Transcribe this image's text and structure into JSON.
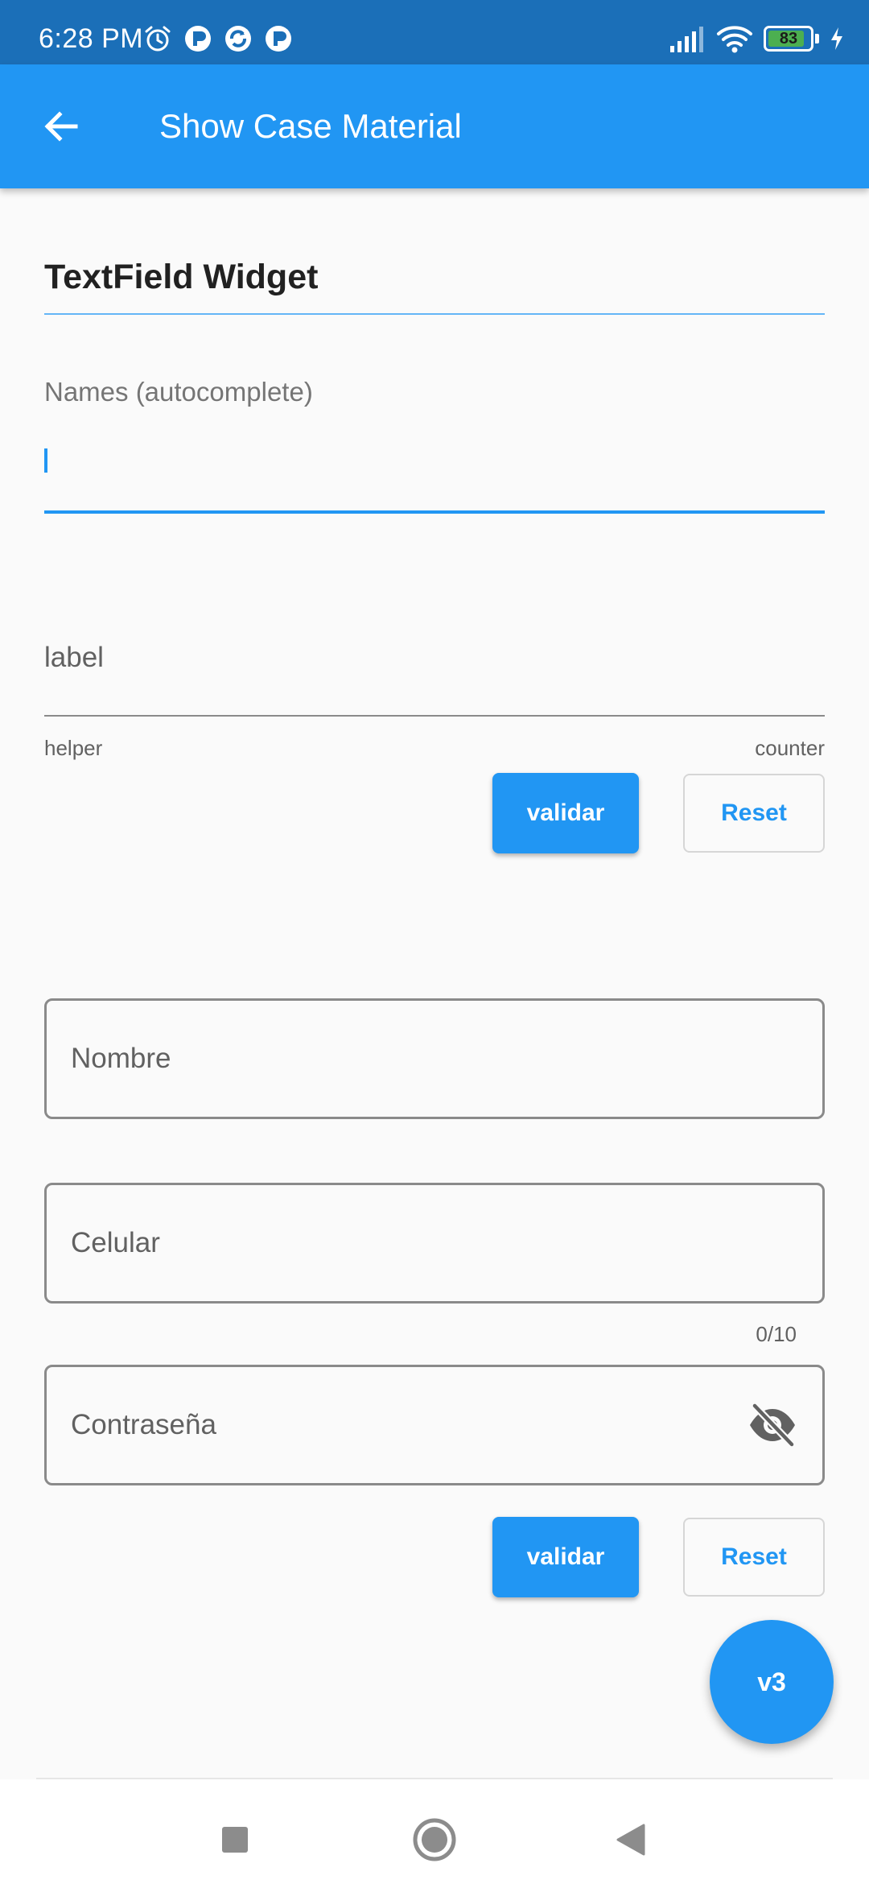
{
  "status_bar": {
    "time": "6:28 PM",
    "battery_level": "83"
  },
  "app_bar": {
    "title": "Show Case Material",
    "back_icon": "arrow-back-icon"
  },
  "section": {
    "title": "TextField Widget"
  },
  "autocomplete": {
    "label": "Names (autocomplete)",
    "value": ""
  },
  "basic_field": {
    "label": "label",
    "helper": "helper",
    "counter": "counter"
  },
  "form1_buttons": {
    "validate_label": "validar",
    "reset_label": "Reset"
  },
  "outlined_fields": {
    "name": {
      "placeholder": "Nombre"
    },
    "phone": {
      "placeholder": "Celular",
      "counter": "0/10"
    },
    "password": {
      "placeholder": "Contraseña",
      "visibility_icon": "visibility-off-icon"
    }
  },
  "form2_buttons": {
    "validate_label": "validar",
    "reset_label": "Reset"
  },
  "fab": {
    "label": "v3"
  },
  "colors": {
    "primary": "#2196f3",
    "status_bar": "#1b6fb8",
    "background": "#fafafa"
  }
}
